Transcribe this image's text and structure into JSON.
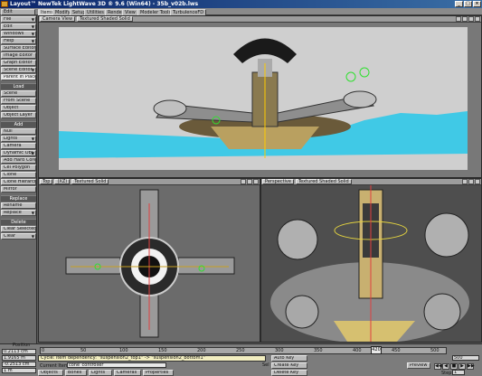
{
  "window": {
    "title": "Layout™ NewTek LightWave 3D ® 9.6 (Win64) - 35b_v02b.lws",
    "controls": [
      "_",
      "□",
      "×"
    ]
  },
  "toolbar": {
    "edit_label": "Edit",
    "tabs": [
      "Items",
      "Modify",
      "Setup",
      "Utilities",
      "Render",
      "View",
      "Modeler Tools",
      "TurbulenceFD"
    ]
  },
  "sidebar": {
    "top_buttons": [
      "File",
      "Edit",
      "Windows",
      "Help",
      "Surface Editor",
      "Image Editor",
      "Graph Editor",
      "Scene Editor",
      "Parent in Place"
    ],
    "load_header": "Load",
    "load_items": [
      "Scene",
      "From Scene",
      "Object",
      "Object Layer"
    ],
    "add_header": "Add",
    "add_items": [
      "Null",
      "Lights",
      "Camera",
      "Dynamic Obj",
      "Add Hard Core",
      "Cel Polygon",
      "Clone",
      "Clone Hierarchy",
      "Mirror"
    ],
    "replace_header": "Replace",
    "replace_items": [
      "Rename",
      "Replace"
    ],
    "delete_header": "Delete",
    "delete_items": [
      "Clear Selected",
      "Clear"
    ]
  },
  "viewports": {
    "top_view": {
      "view": "Camera View",
      "shading": "Textured Shaded Solid"
    },
    "bottom_left": {
      "view": "Top",
      "mode": "(XZ)",
      "shading": "Textured Solid"
    },
    "bottom_right": {
      "view": "Perspective",
      "shading": "Textured Shaded Solid"
    }
  },
  "timeline": {
    "position_label": "Position",
    "x_value": "0.2113 cm",
    "y_value": "1.9165 m",
    "z_value": "-0.2513 cm",
    "grid_value": "1 m",
    "ticks": [
      "0",
      "50",
      "100",
      "150",
      "200",
      "250",
      "300",
      "350",
      "400",
      "450",
      "500"
    ],
    "current_frame": "420",
    "message": "Cycle: item dependency: \"suspension2_top1\" -> \"suspension2_bottom1\"",
    "current_item_label": "Current Item",
    "current_item_value": "cone_controller",
    "objects_dropdown": "Objects",
    "bones_button": "Bones",
    "lights_button": "Lights",
    "cameras_button": "Cameras",
    "properties_button": "Properties",
    "sel_label": "Sel",
    "auto_key_button": "Auto Key",
    "create_key_button": "Create Key",
    "delete_key_button": "Delete Key",
    "preview_dropdown": "Preview",
    "step_label": "Step",
    "step_value": "1",
    "end_frame": "500"
  },
  "colors": {
    "water": "#30c8e8",
    "bg": "#6b6b6b",
    "message_bg": "#f2eec0"
  }
}
